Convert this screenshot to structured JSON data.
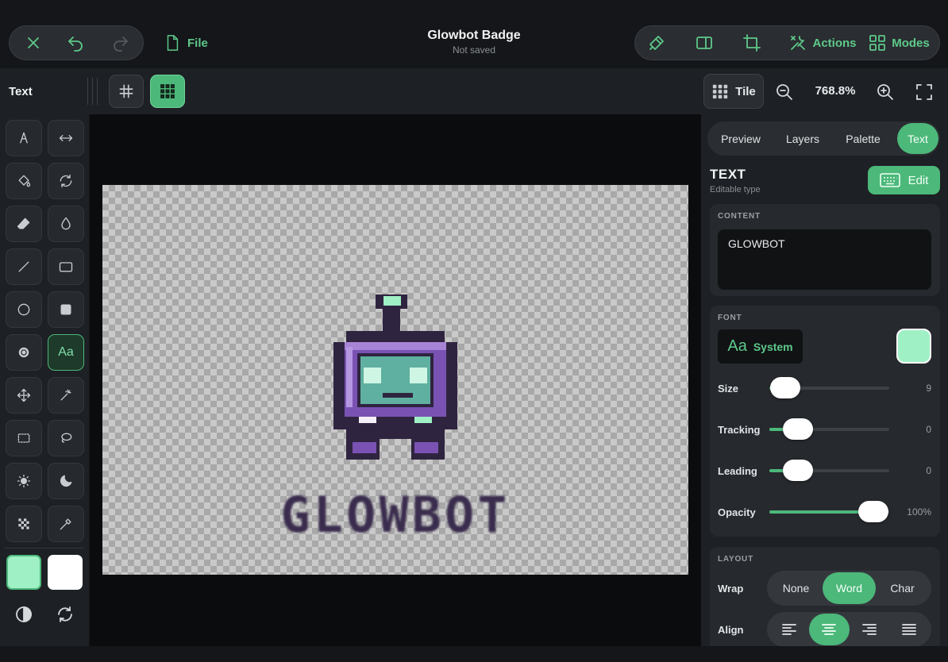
{
  "header": {
    "title": "Glowbot Badge",
    "subtitle": "Not saved",
    "file_label": "File",
    "actions_label": "Actions",
    "modes_label": "Modes"
  },
  "toolbar": {
    "tool_name": "Text",
    "tile_label": "Tile",
    "zoom": "768.8%"
  },
  "canvas": {
    "text": "GLOWBOT",
    "colors": {
      "robot_purple": "#7a52b3",
      "robot_face": "#5fb0a0",
      "robot_dark": "#2f2440",
      "glow_green": "#9ff0c4"
    }
  },
  "tools": [
    "pen-icon",
    "flip-horizontal-icon",
    "fill-bucket-icon",
    "rotate-icon",
    "eraser-icon",
    "dropper-blur-icon",
    "line-icon",
    "rectangle-icon",
    "ellipse-icon",
    "filled-rectangle-icon",
    "radial-icon",
    "text-tool",
    "move-icon",
    "magic-wand-icon",
    "marquee-icon",
    "lasso-icon",
    "brighten-icon",
    "darken-icon",
    "dither-icon",
    "eyedropper-icon"
  ],
  "text_tool_label": "Aa",
  "swatches": {
    "primary": "#9ff0c4",
    "secondary": "#ffffff"
  },
  "panel": {
    "tabs": [
      {
        "label": "Preview",
        "active": false
      },
      {
        "label": "Layers",
        "active": false
      },
      {
        "label": "Palette",
        "active": false
      },
      {
        "label": "Text",
        "active": true
      }
    ],
    "heading": "TEXT",
    "subheading": "Editable type",
    "edit_label": "Edit",
    "content_label": "CONTENT",
    "content_value": "GLOWBOT",
    "font_label": "FONT",
    "font_glyph": "Aa",
    "font_name": "System",
    "font_color": "#9ff0c4",
    "sliders": [
      {
        "label": "Size",
        "value": "9",
        "fraction": 0.13
      },
      {
        "label": "Tracking",
        "value": "0",
        "fraction": 0.24
      },
      {
        "label": "Leading",
        "value": "0",
        "fraction": 0.24
      },
      {
        "label": "Opacity",
        "value": "100%",
        "fraction": 0.87
      }
    ],
    "layout_label": "LAYOUT",
    "wrap_label": "Wrap",
    "wrap_options": [
      {
        "label": "None",
        "active": false
      },
      {
        "label": "Word",
        "active": true
      },
      {
        "label": "Char",
        "active": false
      }
    ],
    "align_label": "Align",
    "align_options": [
      {
        "icon": "align-left-icon",
        "active": false
      },
      {
        "icon": "align-center-icon",
        "active": true
      },
      {
        "icon": "align-right-icon",
        "active": false
      },
      {
        "icon": "align-justify-icon",
        "active": false
      }
    ]
  }
}
